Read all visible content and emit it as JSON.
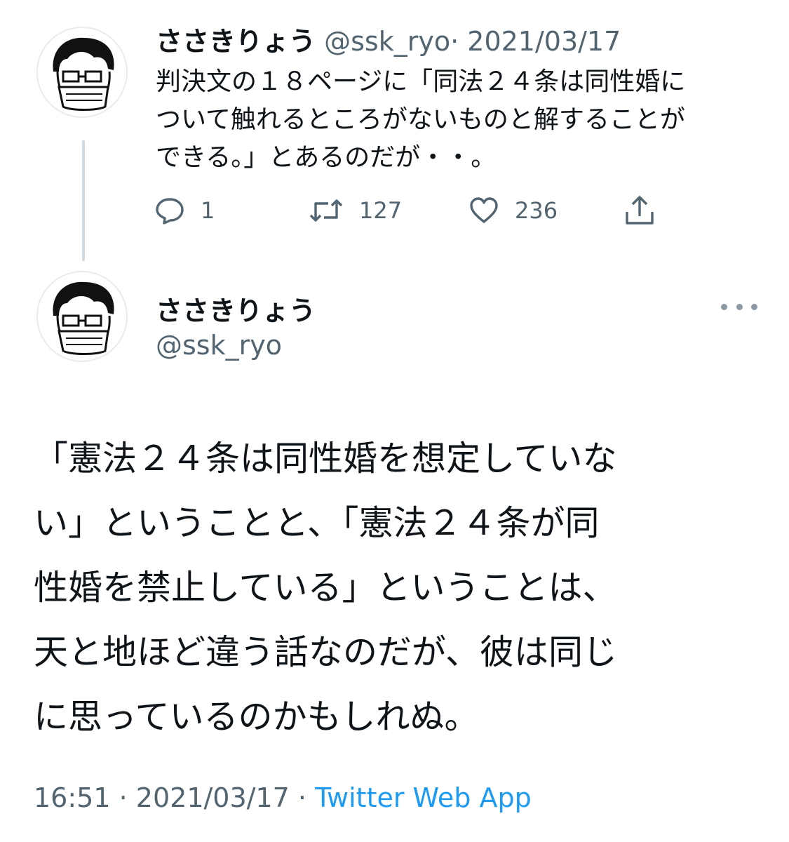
{
  "tweet1": {
    "name": "ささきりょう",
    "handle": "@ssk_ryo",
    "separator": "·",
    "date": "2021/03/17",
    "lines": [
      "判決文の１８ページに「同法２４条は同性婚に",
      "ついて触れるところがないものと解することが",
      "できる。」とあるのだが・・。"
    ],
    "actions": {
      "reply_count": "1",
      "retweet_count": "127",
      "like_count": "236"
    }
  },
  "tweet2": {
    "name": "ささきりょう",
    "handle": "@ssk_ryo",
    "lines": [
      "「憲法２４条は同性婚を想定していな",
      "い」ということと、「憲法２４条が同",
      "性婚を禁止している」ということは、",
      "天と地ほど違う話なのだが、彼は同じ",
      "に思っているのかもしれぬ。"
    ],
    "time": "16:51",
    "separator": "·",
    "date": "2021/03/17",
    "app": "Twitter Web App"
  },
  "colors": {
    "text": "#0f1419",
    "secondary": "#536471",
    "accent": "#1d9bf0",
    "thread_line": "#cfd9de"
  },
  "icons": [
    "reply-icon",
    "retweet-icon",
    "like-icon",
    "share-icon",
    "more-icon"
  ]
}
